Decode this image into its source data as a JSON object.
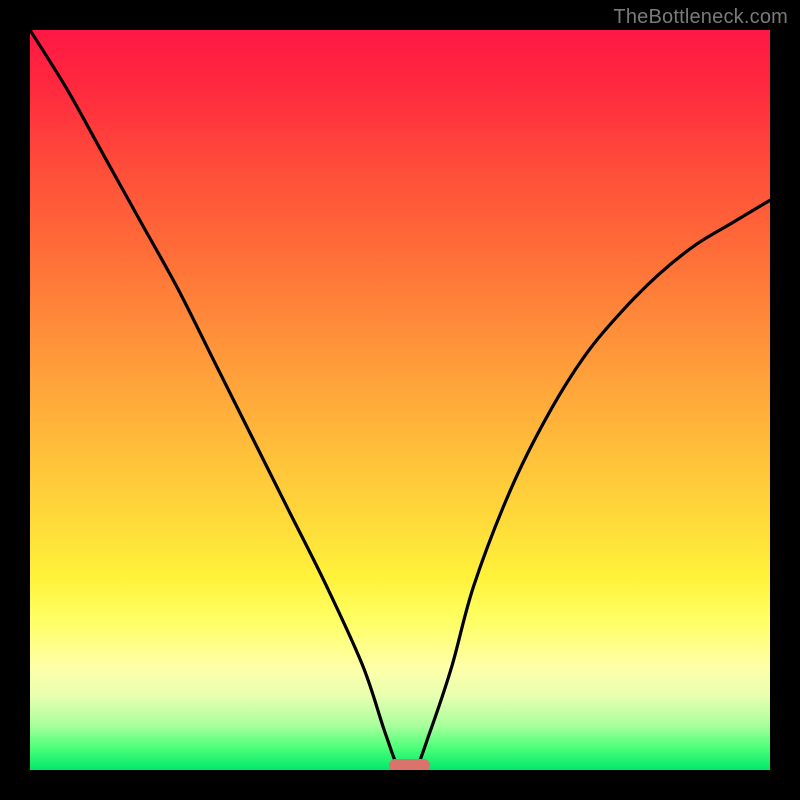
{
  "watermark": "TheBottleneck.com",
  "chart_data": {
    "type": "line",
    "title": "",
    "xlabel": "",
    "ylabel": "",
    "xlim": [
      0,
      100
    ],
    "ylim": [
      0,
      100
    ],
    "grid": false,
    "legend": false,
    "background_gradient": {
      "direction": "vertical",
      "stops": [
        {
          "pos": 0,
          "color": "#ff1744"
        },
        {
          "pos": 30,
          "color": "#ff6d38"
        },
        {
          "pos": 66,
          "color": "#ffd93a"
        },
        {
          "pos": 86,
          "color": "#ffffa8"
        },
        {
          "pos": 100,
          "color": "#00e86b"
        }
      ]
    },
    "series": [
      {
        "name": "bottleneck-curve",
        "color": "#000000",
        "x": [
          0,
          5,
          10,
          15,
          20,
          25,
          30,
          35,
          40,
          45,
          48,
          50,
          52,
          54,
          57,
          60,
          65,
          70,
          75,
          80,
          85,
          90,
          95,
          100
        ],
        "y": [
          100,
          92,
          83,
          74,
          65,
          55,
          45,
          35,
          25,
          14,
          5,
          0,
          0,
          5,
          14,
          25,
          38,
          48,
          56,
          62,
          67,
          71,
          74,
          77
        ]
      }
    ],
    "marker": {
      "x_start": 48.5,
      "x_end": 54,
      "color": "#d9736b"
    },
    "frame_color": "#000000"
  }
}
